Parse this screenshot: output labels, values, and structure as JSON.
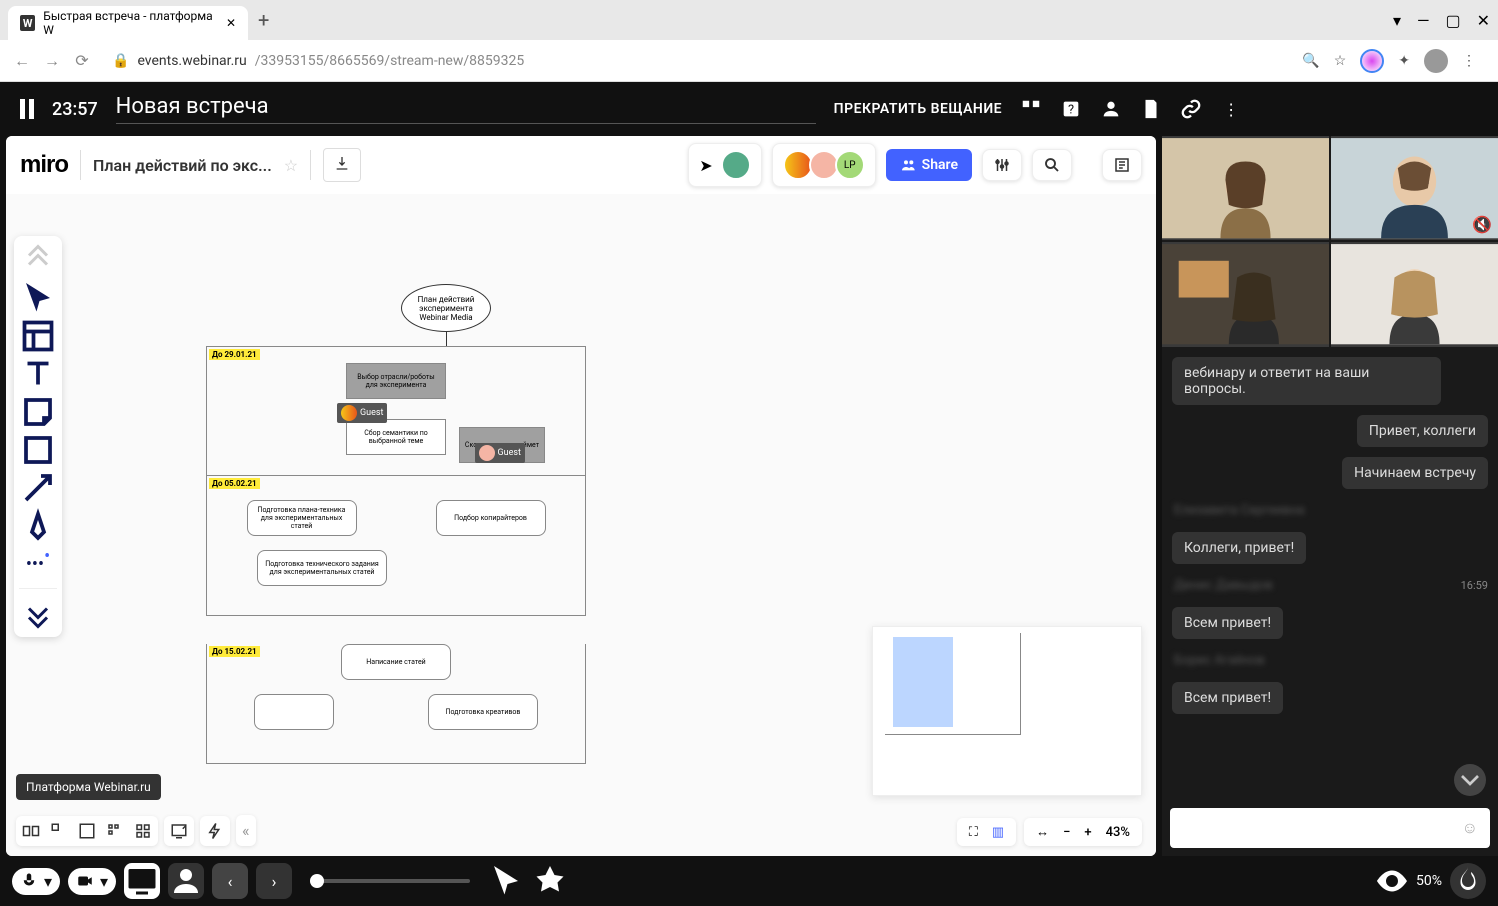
{
  "browser": {
    "tab_title": "Быстрая встреча - платформа W",
    "url_domain": "events.webinar.ru",
    "url_path": "/33953155/8665569/stream-new/8859325"
  },
  "header": {
    "timer": "23:57",
    "meeting_name": "Новая встреча",
    "stop_broadcast": "ПРЕКРАТИТЬ ВЕЩАНИЕ"
  },
  "miro": {
    "logo": "miro",
    "board_title": "План действий по экс...",
    "share_label": "Share",
    "zoom_percent": "43%"
  },
  "flowchart": {
    "title": "План действий\nэксперимента\nWebinar Media",
    "frames": [
      {
        "label": "До 29.01.21",
        "boxes": [
          "Выбор отрасли/роботы для эксперимента",
          "Сбор семантики по выбранной теме"
        ],
        "side": "Сколько часов займет"
      },
      {
        "label": "До 05.02.21",
        "boxes": [
          "Подготовка плана-техника для экспериментальных статей",
          "Подбор копирайтеров",
          "Подготовка технического задания для экспериментальных статей"
        ]
      },
      {
        "label": "До 15.02.21",
        "boxes": [
          "Написание статей",
          "Подготовка креативов"
        ]
      }
    ],
    "guest_labels": [
      "Guest",
      "Guest"
    ],
    "participant_badge": "LP"
  },
  "tooltip": {
    "bottom_left": "Платформа Webinar.ru"
  },
  "chat": {
    "messages": [
      {
        "text": "вебинару и ответит на ваши вопросы.",
        "side": "wide"
      },
      {
        "text": "Привет, коллеги",
        "side": "right"
      },
      {
        "text": "Начинаем встречу",
        "side": "right"
      },
      {
        "name": "Елизавета Сергеевна"
      },
      {
        "text": "Коллеги, привет!",
        "side": "left"
      },
      {
        "name": "Денис Давыдов",
        "time": "16:59"
      },
      {
        "text": "Всем привет!",
        "side": "left"
      },
      {
        "name": "Борис Агаёнов"
      },
      {
        "text": "Всем привет!",
        "side": "left"
      }
    ],
    "input_placeholder": ""
  },
  "bottom_bar": {
    "visibility_percent": "50%"
  }
}
